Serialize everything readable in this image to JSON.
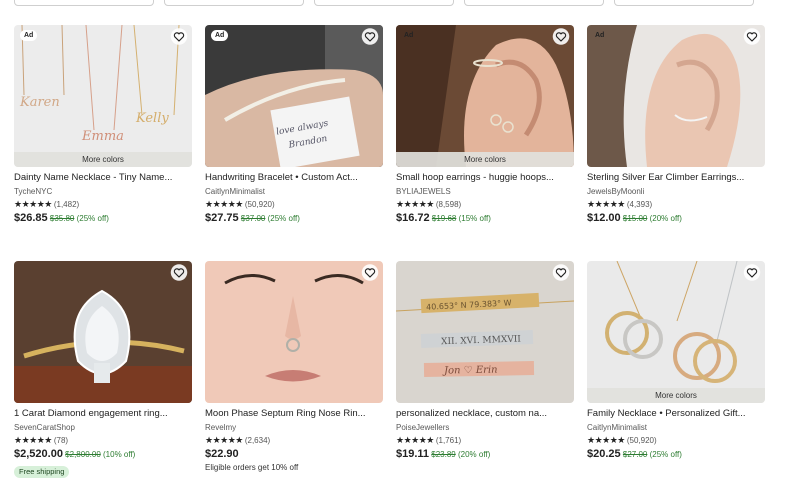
{
  "ad_label": "Ad",
  "more_colors_label": "More colors",
  "star_glyphs": "★★★★★",
  "icons": {
    "favorite": "heart-outline-icon"
  },
  "colors": {
    "discount_green": "#2e7d32",
    "free_shipping_bg": "#d7f0d9"
  },
  "products": [
    {
      "title": "Dainty Name Necklace - Tiny Name...",
      "shop": "TycheNYC",
      "rating": 5,
      "reviews": "(1,482)",
      "price": "$26.85",
      "original": "$35.80",
      "discount": "(25% off)",
      "ad": true,
      "more_colors": true
    },
    {
      "title": "Handwriting Bracelet • Custom Act...",
      "shop": "CaitlynMinimalist",
      "rating": 5,
      "reviews": "(50,920)",
      "price": "$27.75",
      "original": "$37.00",
      "discount": "(25% off)",
      "ad": true,
      "more_colors": false
    },
    {
      "title": "Small hoop earrings - huggie hoops...",
      "shop": "BYLIAJEWELS",
      "rating": 5,
      "reviews": "(8,598)",
      "price": "$16.72",
      "original": "$19.68",
      "discount": "(15% off)",
      "ad": true,
      "more_colors": true
    },
    {
      "title": "Sterling Silver Ear Climber Earrings...",
      "shop": "JewelsByMoonli",
      "rating": 5,
      "reviews": "(4,393)",
      "price": "$12.00",
      "original": "$15.00",
      "discount": "(20% off)",
      "ad": true,
      "more_colors": false
    },
    {
      "title": "1 Carat Diamond engagement ring...",
      "shop": "SevenCaratShop",
      "rating": 5,
      "reviews": "(78)",
      "price": "$2,520.00",
      "original": "$2,800.00",
      "discount": "(10% off)",
      "ad": false,
      "more_colors": false,
      "badge": "Free shipping"
    },
    {
      "title": "Moon Phase Septum Ring Nose Rin...",
      "shop": "Revelmy",
      "rating": 5,
      "reviews": "(2,634)",
      "price": "$22.90",
      "original": "",
      "discount": "",
      "ad": false,
      "more_colors": false,
      "note": "Eligible orders get 10% off"
    },
    {
      "title": "personalized necklace, custom na...",
      "shop": "PoiseJewellers",
      "rating": 5,
      "reviews": "(1,761)",
      "price": "$19.11",
      "original": "$23.89",
      "discount": "(20% off)",
      "ad": false,
      "more_colors": false
    },
    {
      "title": "Family Necklace • Personalized Gift...",
      "shop": "CaitlynMinimalist",
      "rating": 5,
      "reviews": "(50,920)",
      "price": "$20.25",
      "original": "$27.00",
      "discount": "(25% off)",
      "ad": false,
      "more_colors": true
    }
  ]
}
